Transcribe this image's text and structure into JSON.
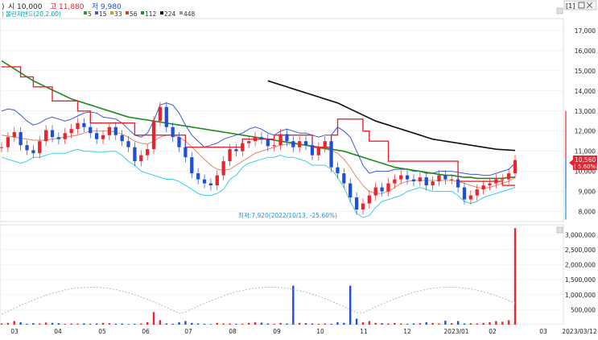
{
  "header": {
    "open_label": "시",
    "open_value": "10,000",
    "high_label": "고",
    "high_value": "11,880",
    "low_label": "저",
    "low_value": "9,980",
    "controls": "[1]",
    "colors": {
      "up": "#e8242f",
      "down": "#1f4fd6",
      "text": "#222222"
    }
  },
  "indicator_legend": {
    "bollinger": "볼린저밴드(20,2.00)",
    "ma_periods": [
      "5",
      "15",
      "33",
      "56",
      "112",
      "224",
      "448"
    ],
    "ma_colors": [
      "#2c9a2c",
      "#3a5ad8",
      "#c9a400",
      "#d04020",
      "#2a8a2a",
      "#111111",
      "#9a9a9a"
    ]
  },
  "annotation": "최저:7,920(2022/10/13, -25.60%)",
  "price_badge": {
    "price": "10,560",
    "change": "( 5.60%)"
  },
  "chart_data": [
    {
      "type": "candlestick",
      "title": "",
      "x_labels": [
        "03",
        "04",
        "05",
        "06",
        "07",
        "08",
        "09",
        "10",
        "11",
        "12",
        "2023/01",
        "02",
        "03",
        "2023/03/12"
      ],
      "y_ticks": [
        8000,
        9000,
        10000,
        11000,
        12000,
        13000,
        14000,
        15000,
        16000,
        17000
      ],
      "ylim": [
        7500,
        17600
      ],
      "series": [
        {
          "name": "close",
          "values": [
            11200,
            11700,
            11950,
            11300,
            11050,
            10900,
            11500,
            12050,
            11700,
            11600,
            11900,
            12100,
            12400,
            12200,
            11900,
            11600,
            11800,
            12200,
            11800,
            11500,
            11200,
            10500,
            10800,
            11100,
            12500,
            13200,
            12200,
            11700,
            11200,
            10700,
            9900,
            9600,
            9400,
            9300,
            9800,
            10500,
            11100,
            11000,
            11400,
            11500,
            11700,
            11600,
            11250,
            11300,
            11850,
            11500,
            11200,
            11500,
            11300,
            10800,
            11200,
            11500,
            10200,
            9900,
            9400,
            8700,
            8100,
            8400,
            8800,
            9200,
            9000,
            9400,
            9600,
            9800,
            9600,
            9500,
            9700,
            9300,
            9500,
            9800,
            9600,
            9600,
            9200,
            8600,
            8800,
            9100,
            9300,
            9400,
            9600,
            9600,
            9900,
            10560
          ]
        },
        {
          "name": "upper_bollinger",
          "values": [
            13000,
            13100,
            13050,
            12800,
            12500,
            12300,
            12400,
            12600,
            12700,
            12600,
            12500,
            12600,
            12750,
            12900,
            12950,
            12900,
            12700,
            12650,
            12600,
            12400,
            12100,
            11800,
            11700,
            11900,
            12500,
            13300,
            13400,
            13300,
            12900,
            12300,
            11800,
            11500,
            11200,
            11300,
            11400,
            11600,
            11700,
            11800,
            11900,
            12100,
            12200,
            12100,
            11900,
            11800,
            12000,
            12100,
            12000,
            11900,
            11900,
            11800,
            11700,
            11800,
            11800,
            12200,
            12000,
            11700,
            11000,
            10300,
            9900,
            10000,
            10000,
            10000,
            10100,
            10100,
            10100,
            10000,
            10000,
            9900,
            9900,
            10000,
            10000,
            10000,
            9950,
            9900,
            9850,
            9850,
            9800,
            9800,
            9900,
            10000,
            10100,
            10400
          ]
        },
        {
          "name": "lower_bollinger",
          "values": [
            10700,
            10600,
            10500,
            10400,
            10500,
            10700,
            10700,
            10800,
            10900,
            10900,
            10900,
            11000,
            11100,
            11000,
            11000,
            10950,
            10950,
            11000,
            11000,
            10800,
            10500,
            10300,
            10000,
            9900,
            9800,
            9700,
            9600,
            9600,
            9500,
            9300,
            9100,
            8900,
            8800,
            8800,
            8900,
            9100,
            9600,
            9800,
            10200,
            10400,
            10500,
            10600,
            10700,
            10700,
            10800,
            10700,
            10700,
            10600,
            10500,
            10300,
            10300,
            10300,
            10100,
            9700,
            9200,
            8500,
            7900,
            7700,
            7800,
            8200,
            8500,
            8600,
            8700,
            8800,
            9000,
            9100,
            9200,
            9100,
            9000,
            9000,
            9000,
            9000,
            8800,
            8500,
            8400,
            8500,
            8700,
            8800,
            8900,
            9000,
            9100,
            9200
          ]
        },
        {
          "name": "ma_112",
          "values": [
            15500,
            15300,
            15100,
            14900,
            14700,
            14500,
            14350,
            14200,
            14050,
            13900,
            13750,
            13600,
            13500,
            13400,
            13300,
            13200,
            13100,
            13000,
            12900,
            12800,
            12700,
            12650,
            12600,
            12550,
            12500,
            12450,
            12400,
            12350,
            12300,
            12250,
            12200,
            12150,
            12100,
            12050,
            12000,
            11950,
            11900,
            11850,
            11800,
            11750,
            11700,
            11650,
            11600,
            11550,
            11500,
            11450,
            11400,
            11350,
            11300,
            11250,
            11200,
            11150,
            11100,
            11050,
            11000,
            10900,
            10800,
            10700,
            10600,
            10500,
            10400,
            10300,
            10200,
            10150,
            10100,
            10050,
            10000,
            9950,
            9900,
            9850,
            9800,
            9800,
            9750,
            9700,
            9700,
            9650,
            9650,
            9650,
            9650,
            9650,
            9700,
            9700
          ]
        },
        {
          "name": "ma_224",
          "values": [
            null,
            null,
            null,
            null,
            null,
            null,
            null,
            null,
            null,
            null,
            null,
            null,
            null,
            null,
            null,
            null,
            null,
            null,
            null,
            null,
            null,
            null,
            null,
            null,
            null,
            null,
            null,
            null,
            null,
            null,
            null,
            null,
            null,
            null,
            null,
            null,
            null,
            null,
            null,
            null,
            null,
            null,
            14500,
            14400,
            14300,
            14200,
            14100,
            14000,
            13900,
            13800,
            13700,
            13600,
            13500,
            13400,
            13250,
            13100,
            12950,
            12800,
            12650,
            12500,
            12400,
            12300,
            12200,
            12100,
            12000,
            11900,
            11800,
            11700,
            11600,
            11550,
            11500,
            11450,
            11400,
            11350,
            11300,
            11250,
            11200,
            11150,
            11100,
            11080,
            11060,
            11040
          ]
        },
        {
          "name": "envelope_step",
          "values": [
            15200,
            15200,
            15200,
            14700,
            14700,
            14200,
            14200,
            14200,
            13500,
            13500,
            13500,
            13500,
            13000,
            13000,
            12400,
            12400,
            12400,
            12400,
            12400,
            12400,
            12400,
            11800,
            11800,
            11800,
            11800,
            11800,
            11800,
            11800,
            11800,
            11200,
            11200,
            11200,
            11200,
            11200,
            11200,
            11200,
            11200,
            11200,
            11600,
            11600,
            11600,
            11600,
            11600,
            11800,
            11800,
            11800,
            11800,
            11800,
            11800,
            11200,
            11200,
            11200,
            11800,
            12600,
            12600,
            12600,
            12600,
            12000,
            11500,
            11500,
            11500,
            10500,
            10500,
            10500,
            10500,
            10500,
            10500,
            10500,
            10500,
            10500,
            10500,
            10500,
            9500,
            9500,
            9500,
            9500,
            9500,
            9500,
            9500,
            9300,
            9300,
            9300
          ]
        },
        {
          "name": "ma_15",
          "values": [
            11800,
            11750,
            11700,
            11650,
            11600,
            11550,
            11550,
            11550,
            11600,
            11650,
            11700,
            11750,
            11800,
            11900,
            12000,
            12000,
            12000,
            12000,
            11950,
            11850,
            11700,
            11500,
            11400,
            11350,
            11500,
            11700,
            11800,
            11800,
            11700,
            11500,
            11200,
            10900,
            10600,
            10300,
            10100,
            10050,
            10100,
            10300,
            10500,
            10700,
            10900,
            11000,
            11100,
            11200,
            11300,
            11350,
            11350,
            11350,
            11300,
            11200,
            11150,
            11100,
            11050,
            10900,
            10600,
            10200,
            9700,
            9300,
            9000,
            8900,
            8900,
            9000,
            9200,
            9400,
            9500,
            9550,
            9550,
            9550,
            9550,
            9550,
            9550,
            9550,
            9500,
            9400,
            9300,
            9200,
            9150,
            9200,
            9300,
            9400,
            9500,
            9700
          ]
        }
      ]
    },
    {
      "type": "bar",
      "title": "",
      "y_ticks": [
        500000,
        1000000,
        1500000,
        2000000,
        2500000,
        3000000
      ],
      "ylim": [
        0,
        3250000
      ],
      "series": [
        {
          "name": "volume",
          "values": [
            40000,
            60000,
            120000,
            80000,
            30000,
            50000,
            40000,
            70000,
            60000,
            50000,
            30000,
            40000,
            35000,
            45000,
            30000,
            40000,
            60000,
            50000,
            30000,
            40000,
            20000,
            30000,
            40000,
            80000,
            420000,
            150000,
            40000,
            30000,
            80000,
            120000,
            60000,
            40000,
            30000,
            20000,
            60000,
            40000,
            40000,
            30000,
            30000,
            60000,
            80000,
            70000,
            40000,
            30000,
            60000,
            40000,
            1300000,
            60000,
            50000,
            40000,
            30000,
            40000,
            30000,
            80000,
            60000,
            1300000,
            200000,
            80000,
            120000,
            60000,
            50000,
            40000,
            60000,
            40000,
            30000,
            40000,
            50000,
            80000,
            60000,
            40000,
            130000,
            50000,
            120000,
            40000,
            50000,
            40000,
            60000,
            80000,
            120000,
            100000,
            150000,
            3220000
          ]
        }
      ]
    }
  ]
}
